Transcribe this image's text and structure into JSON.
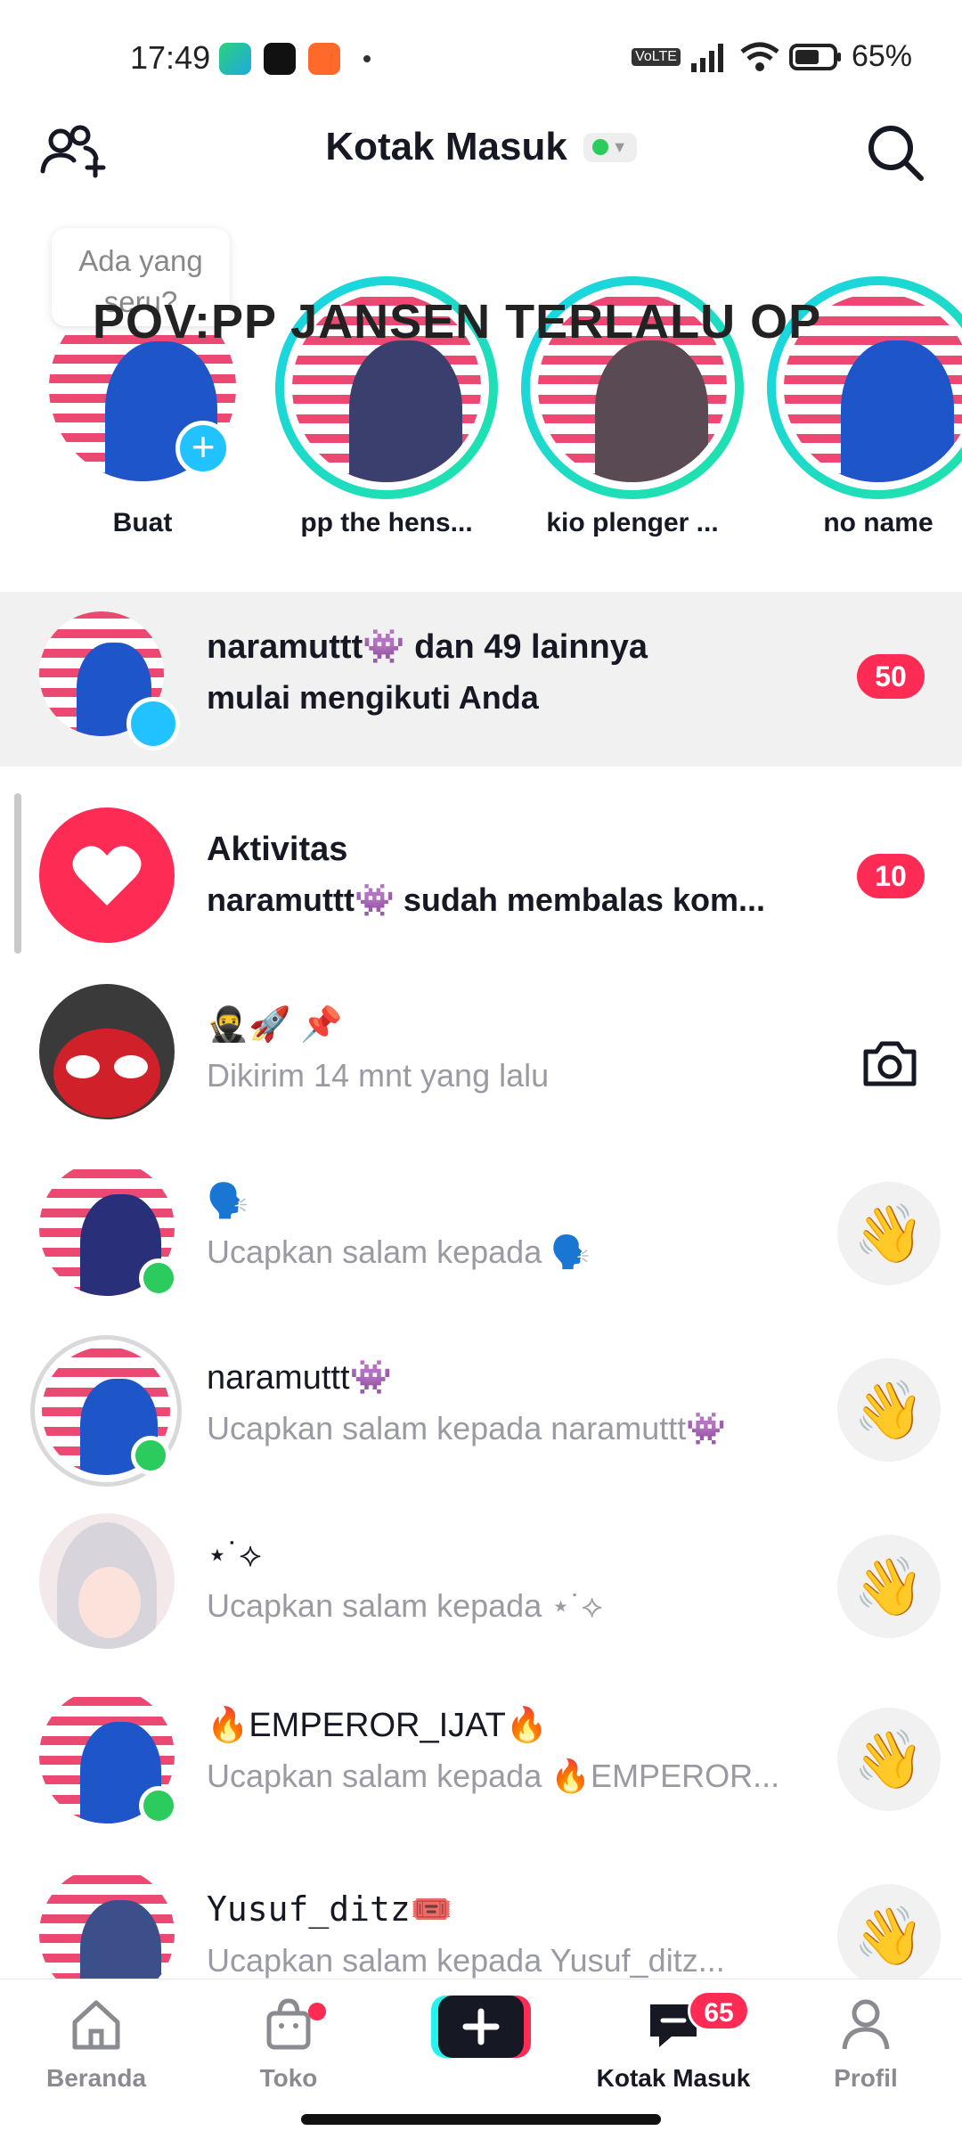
{
  "status_bar": {
    "time": "17:49",
    "battery": "65%",
    "network": "Vo LTE"
  },
  "header": {
    "title": "Kotak Masuk"
  },
  "overlay": {
    "text": "POV:PP JANSEN TERLALU OP"
  },
  "stories": {
    "bubble": "Ada yang seru?",
    "items": [
      {
        "name": "Buat"
      },
      {
        "name": "pp the hens..."
      },
      {
        "name": "kio plenger ..."
      },
      {
        "name": "no name"
      }
    ]
  },
  "rows": [
    {
      "title": "naramuttt👾 dan 49 lainnya",
      "subtitle": "mulai mengikuti Anda",
      "badge": "50"
    },
    {
      "title": "Aktivitas",
      "subtitle": "naramuttt👾 sudah membalas kom...",
      "badge": "10"
    },
    {
      "title": "🥷🚀 📌",
      "subtitle": "Dikirim 14 mnt yang lalu"
    },
    {
      "title": "🗣️",
      "subtitle": "Ucapkan salam kepada 🗣️"
    },
    {
      "title": "naramuttt👾",
      "subtitle": "Ucapkan salam kepada naramuttt👾"
    },
    {
      "title": "⋆˙⟡",
      "subtitle": "Ucapkan salam kepada ⋆˙⟡"
    },
    {
      "title": "🔥EMPEROR_IJAT🔥",
      "subtitle": "Ucapkan salam kepada 🔥EMPEROR..."
    },
    {
      "title": "Yusuf_ditz🎟️",
      "subtitle": "Ucapkan salam kepada Yusuf_ditz..."
    }
  ],
  "bottom_nav": {
    "items": [
      {
        "label": "Beranda"
      },
      {
        "label": "Toko"
      },
      {
        "label": ""
      },
      {
        "label": "Kotak Masuk",
        "badge": "65"
      },
      {
        "label": "Profil"
      }
    ]
  },
  "colors": {
    "accent": "#fe2c55",
    "online": "#2bcb5d",
    "story_ring": "#1ad3e8"
  }
}
